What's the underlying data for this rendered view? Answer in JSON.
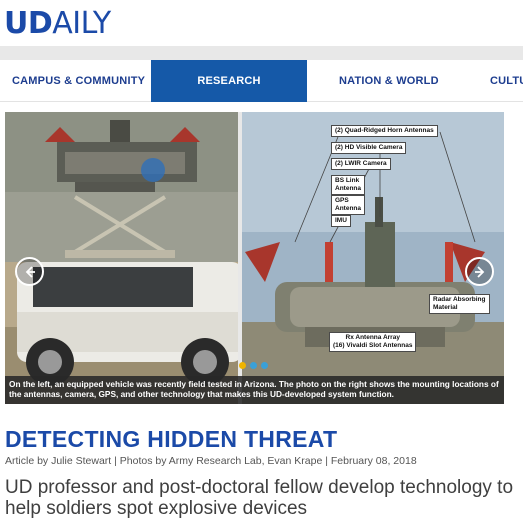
{
  "logo": {
    "ud": "UD",
    "daily": "AILY"
  },
  "nav": {
    "items": [
      {
        "label": "CAMPUS & COMMUNITY",
        "active": false
      },
      {
        "label": "RESEARCH",
        "active": true
      },
      {
        "label": "NATION & WORLD",
        "active": false
      },
      {
        "label": "CULTU",
        "active": false
      }
    ]
  },
  "hero": {
    "caption": "On the left, an equipped vehicle was recently field tested in Arizona. The photo on the right shows the mounting locations of the antennas, camera, GPS, and other technology that makes this UD-developed system function.",
    "labels": {
      "horn": "(2) Quad-Ridged Horn Antennas",
      "hd": "(2) HD Visible Camera",
      "lwir": "(2) LWIR Camera",
      "bs_link_1": "BS Link",
      "bs_link_2": "Antenna",
      "gps_1": "GPS",
      "gps_2": "Antenna",
      "imu": "IMU",
      "radar_1": "Radar Absorbing",
      "radar_2": "Material",
      "rx_1": "Rx Antenna Array",
      "rx_2": "(16) Vivaldi Slot Antennas"
    },
    "prev_icon": "chevron-left-icon",
    "next_icon": "chevron-right-icon",
    "dots": [
      {
        "color": "#f0b400",
        "active": true
      },
      {
        "color": "#3aa0d8",
        "active": false
      },
      {
        "color": "#3aa0d8",
        "active": false
      }
    ]
  },
  "article": {
    "title": "DETECTING HIDDEN THREAT",
    "byline": "Article by Julie Stewart | Photos by Army Research Lab, Evan Krape | February 08, 2018",
    "subtitle": "UD professor and post-doctoral fellow develop technology to help soldiers spot explosive devices"
  },
  "colors": {
    "brand_blue": "#1b4aa8",
    "nav_active": "#1559a8",
    "nav_text": "#1d3d8f"
  }
}
